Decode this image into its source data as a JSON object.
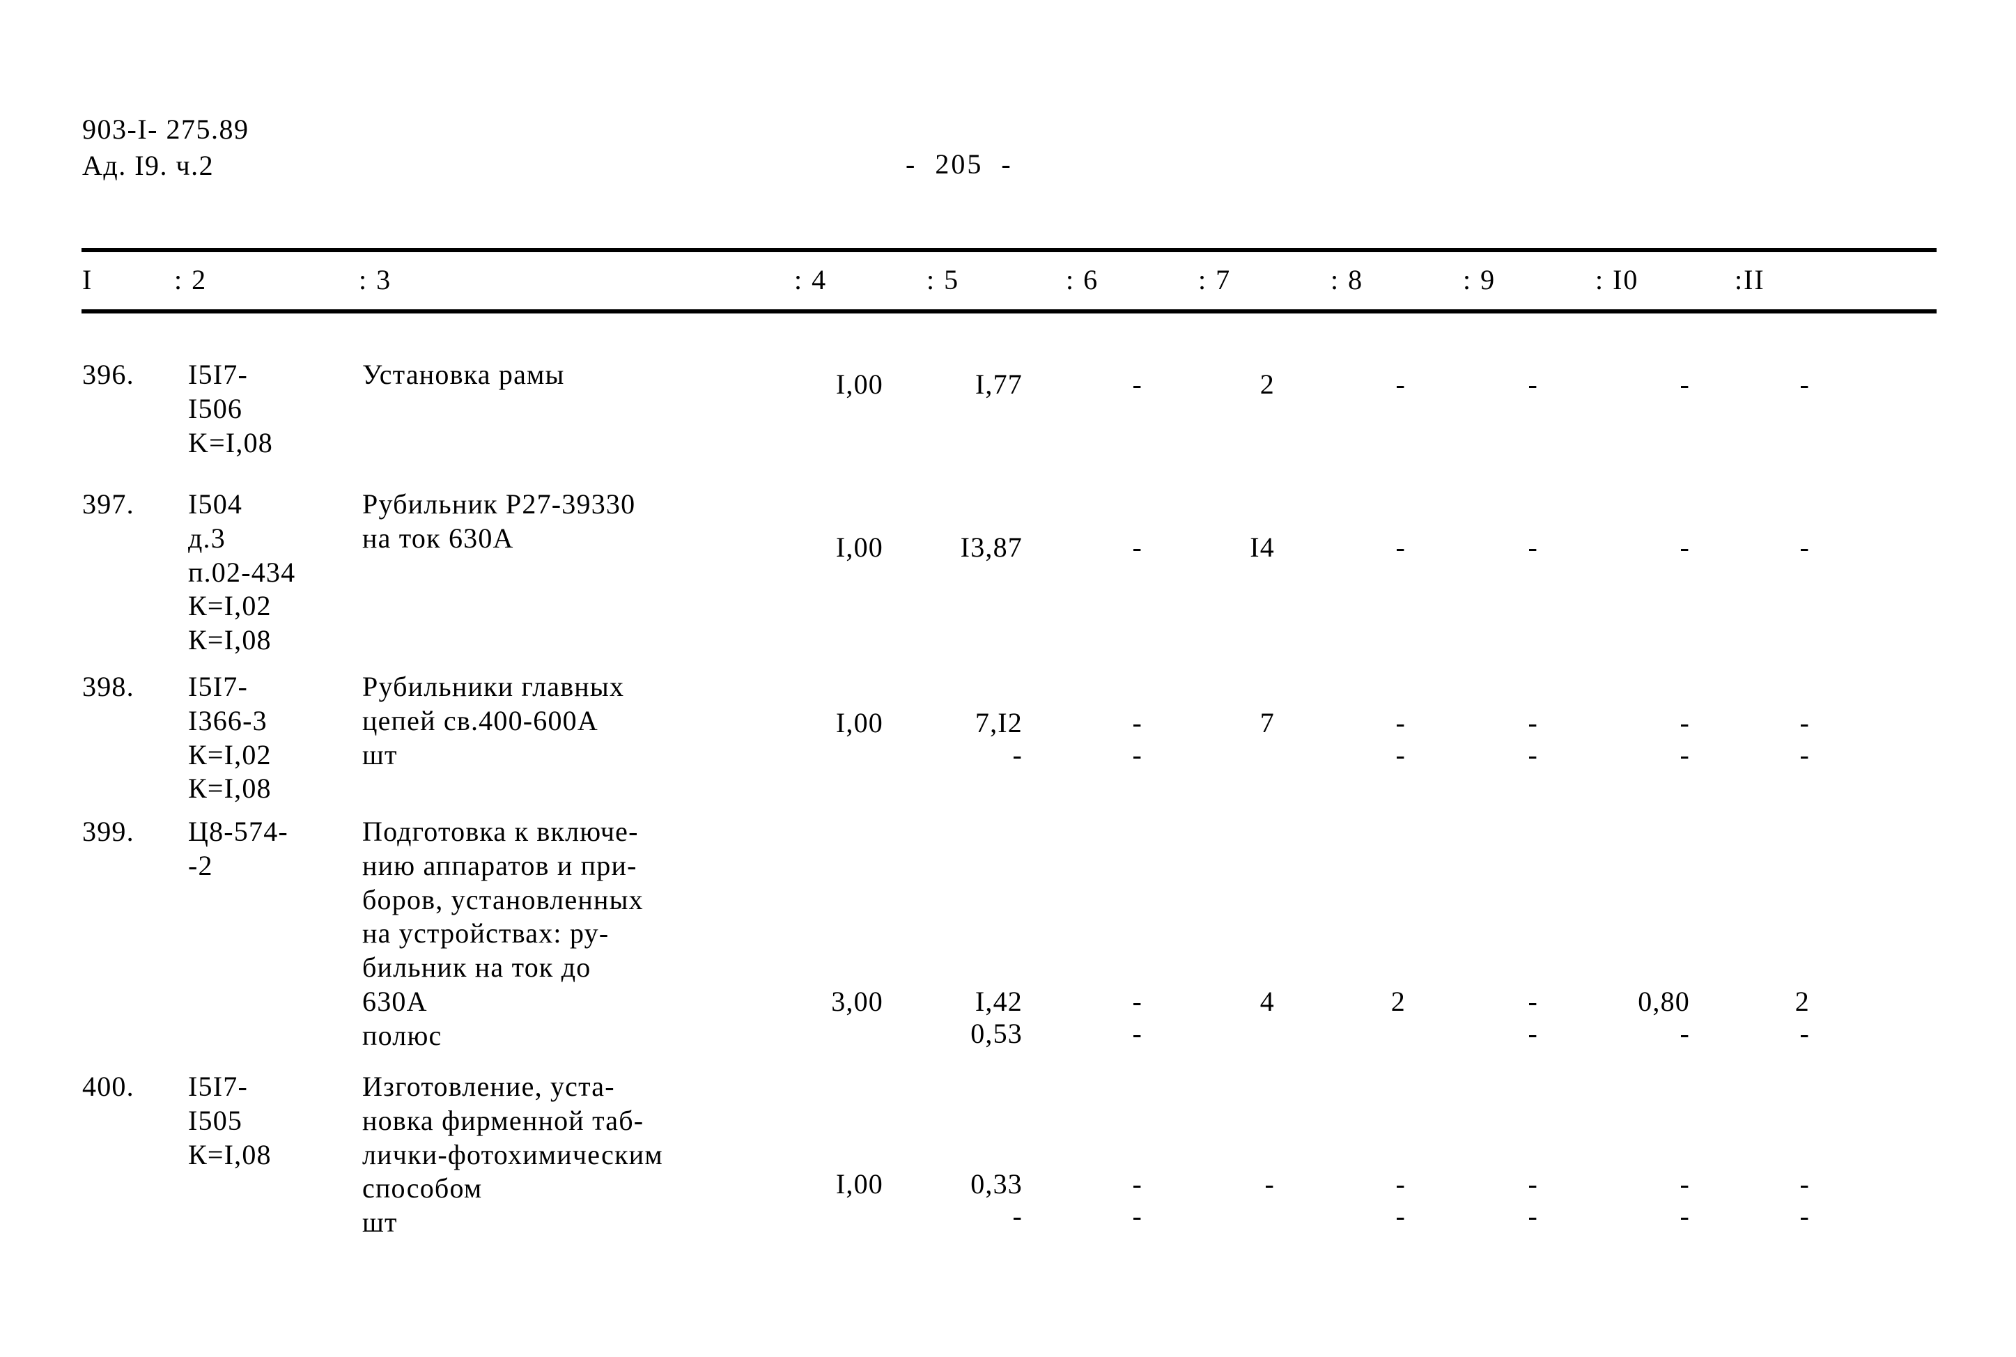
{
  "document": {
    "code_line1": "903-I- 275.89",
    "code_line2": "Ад. I9. ч.2",
    "page_marker": "-  205  -"
  },
  "table": {
    "column_headers": [
      {
        "label": "I"
      },
      {
        "label": ": 2"
      },
      {
        "label": ": 3"
      },
      {
        "label": ": 4"
      },
      {
        "label": ": 5"
      },
      {
        "label": ": 6"
      },
      {
        "label": ": 7"
      },
      {
        "label": ": 8"
      },
      {
        "label": ": 9"
      },
      {
        "label": ": I0"
      },
      {
        "label": ":II"
      }
    ],
    "rows": [
      {
        "number": "396.",
        "code": "I5I7-\nI506\nK=I,08",
        "description": "Установка рамы",
        "c4": "I,00",
        "c5": "I,77",
        "c6": "-",
        "c7": "2",
        "c8": "-",
        "c9": "-",
        "c10": "-",
        "c11": "-",
        "c4b": "",
        "c5b": "",
        "c6b": "",
        "c7b": "",
        "c8b": "",
        "c9b": "",
        "c10b": "",
        "c11b": ""
      },
      {
        "number": "397.",
        "code": "I504\nд.3\nп.02-434\nК=I,02\nК=I,08",
        "description": "Рубильник Р27-39330\nна ток 630А",
        "c4": "I,00",
        "c5": "I3,87",
        "c6": "-",
        "c7": "I4",
        "c8": "-",
        "c9": "-",
        "c10": "-",
        "c11": "-",
        "c4b": "",
        "c5b": "",
        "c6b": "",
        "c7b": "",
        "c8b": "",
        "c9b": "",
        "c10b": "",
        "c11b": ""
      },
      {
        "number": "398.",
        "code": "I5I7-\nI366-3\nК=I,02\nК=I,08",
        "description": "Рубильники главных\nцепей св.400-600А\nшт",
        "c4": "I,00",
        "c5": "7,I2",
        "c6": "-",
        "c7": "7",
        "c8": "-",
        "c9": "-",
        "c10": "-",
        "c11": "-",
        "c4b": "",
        "c5b": "-",
        "c6b": "-",
        "c7b": "",
        "c8b": "-",
        "c9b": "-",
        "c10b": "-",
        "c11b": "-"
      },
      {
        "number": "399.",
        "code": "Ц8-574-\n-2",
        "description": "Подготовка к включе-\nнию аппаратов и при-\nборов, установленных\nна устройствах: ру-\nбильник на ток до\n630А\nполюс",
        "c4": "3,00",
        "c5": "I,42",
        "c6": "-",
        "c7": "4",
        "c8": "2",
        "c9": "-",
        "c10": "0,80",
        "c11": "2",
        "c4b": "",
        "c5b": "0,53",
        "c6b": "-",
        "c7b": "",
        "c8b": "",
        "c9b": "-",
        "c10b": "-",
        "c11b": "-"
      },
      {
        "number": "400.",
        "code": "I5I7-\nI505\nК=I,08",
        "description": "Изготовление, уста-\nновка фирменной таб-\nлички-фотохимическим\nспособом\nшт",
        "c4": "I,00",
        "c5": "0,33",
        "c6": "-",
        "c7": "-",
        "c8": "-",
        "c9": "-",
        "c10": "-",
        "c11": "-",
        "c4b": "",
        "c5b": "-",
        "c6b": "-",
        "c7b": "",
        "c8b": "-",
        "c9b": "-",
        "c10b": "-",
        "c11b": "-"
      }
    ]
  }
}
